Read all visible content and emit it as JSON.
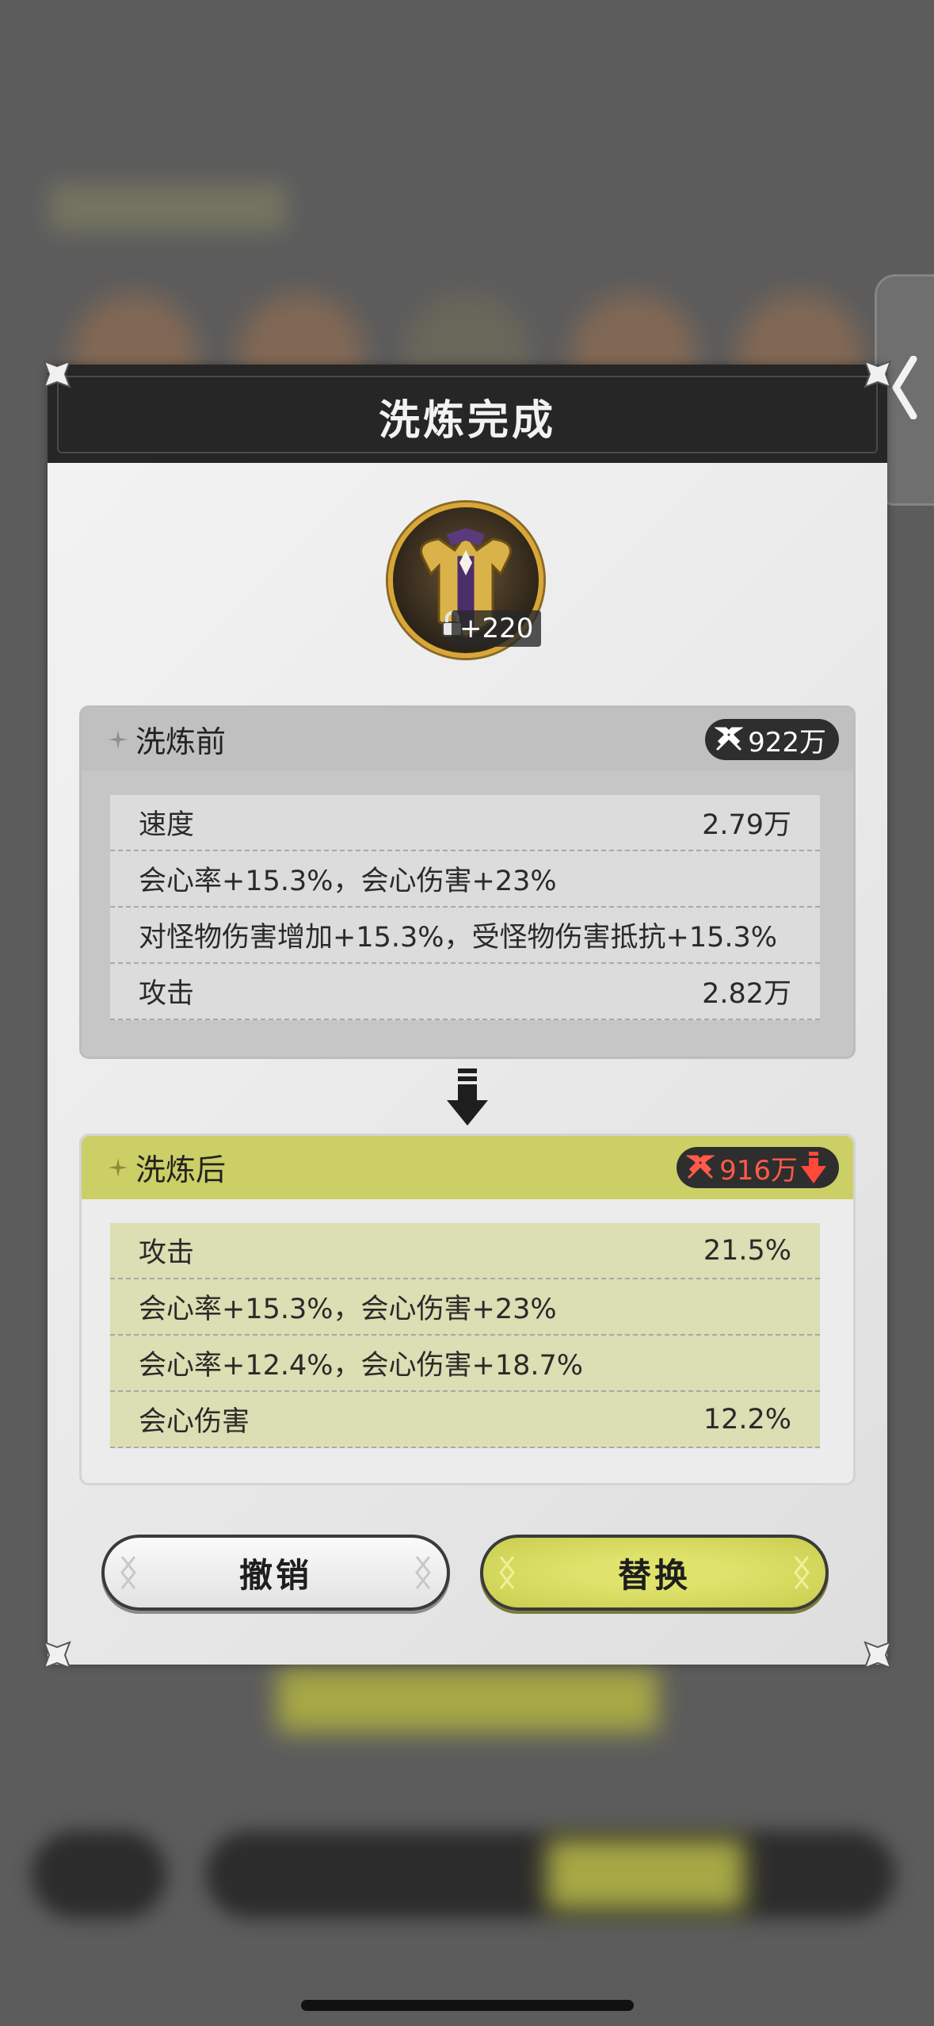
{
  "dialog": {
    "title": "洗炼完成",
    "item": {
      "enhance_level": "+220",
      "locked": true
    }
  },
  "before": {
    "label": "洗炼前",
    "power": "922万",
    "rows": [
      {
        "name": "速度",
        "value": "2.79万"
      },
      {
        "name": "会心率+15.3%，会心伤害+23%",
        "value": ""
      },
      {
        "name": "对怪物伤害增加+15.3%，受怪物伤害抵抗+15.3%",
        "value": ""
      },
      {
        "name": "攻击",
        "value": "2.82万"
      }
    ]
  },
  "after": {
    "label": "洗炼后",
    "power": "916万",
    "power_trend": "down",
    "rows": [
      {
        "name": "攻击",
        "value": "21.5%"
      },
      {
        "name": "会心率+15.3%，会心伤害+23%",
        "value": ""
      },
      {
        "name": "会心率+12.4%，会心伤害+18.7%",
        "value": ""
      },
      {
        "name": "会心伤害",
        "value": "12.2%"
      }
    ]
  },
  "buttons": {
    "cancel": "撤销",
    "replace": "替换"
  },
  "colors": {
    "accent": "#cccf66",
    "power_down": "#ff5a4a",
    "header": "#262626"
  }
}
